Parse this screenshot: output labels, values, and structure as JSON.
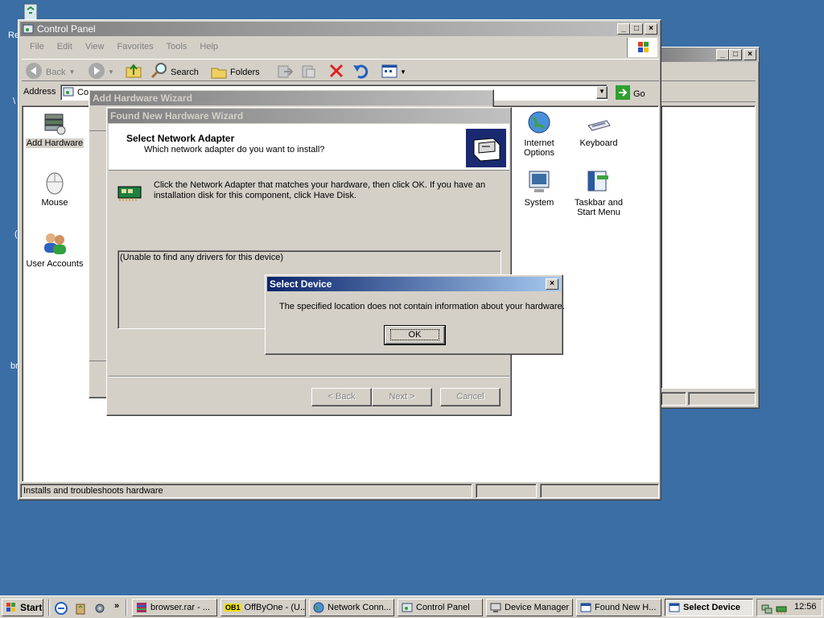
{
  "control_panel": {
    "title": "Control Panel",
    "menu": [
      "File",
      "Edit",
      "View",
      "Favorites",
      "Tools",
      "Help"
    ],
    "toolbar": {
      "back": "Back",
      "search": "Search",
      "folders": "Folders"
    },
    "address_label": "Address",
    "address_value": "Co",
    "go": "Go",
    "status": "Installs and troubleshoots hardware",
    "icons_left": [
      "Add Hardware",
      "Mouse",
      "User Accounts"
    ],
    "icons_right": [
      "Internet Options",
      "Keyboard",
      "System",
      "Taskbar and Start Menu"
    ]
  },
  "add_hardware_wizard": {
    "title": "Add Hardware Wizard"
  },
  "found_new_hardware": {
    "title": "Found New Hardware Wizard",
    "header_title": "Select Network Adapter",
    "header_subtitle": "Which network adapter do you want to install?",
    "instructions": "Click the Network Adapter that matches your hardware, then click OK. If you have an installation disk for this component, click Have Disk.",
    "list_text": "(Unable to find any drivers for this device)",
    "back": "< Back",
    "next": "Next >",
    "cancel": "Cancel"
  },
  "select_device": {
    "title": "Select Device",
    "message": "The specified location does not contain information about your hardware.",
    "ok": "OK"
  },
  "desktop_fragments": [
    "Re",
    "\\",
    "(",
    "br"
  ],
  "taskbar": {
    "start": "Start",
    "chevron": "»",
    "tasks": [
      "browser.rar - ...",
      "OffByOne - (U...",
      "Network Conn...",
      "Control Panel",
      "Device Manager",
      "Found New H...",
      "Select Device"
    ],
    "offbyone_badge": "OB1",
    "clock": "12:56"
  }
}
